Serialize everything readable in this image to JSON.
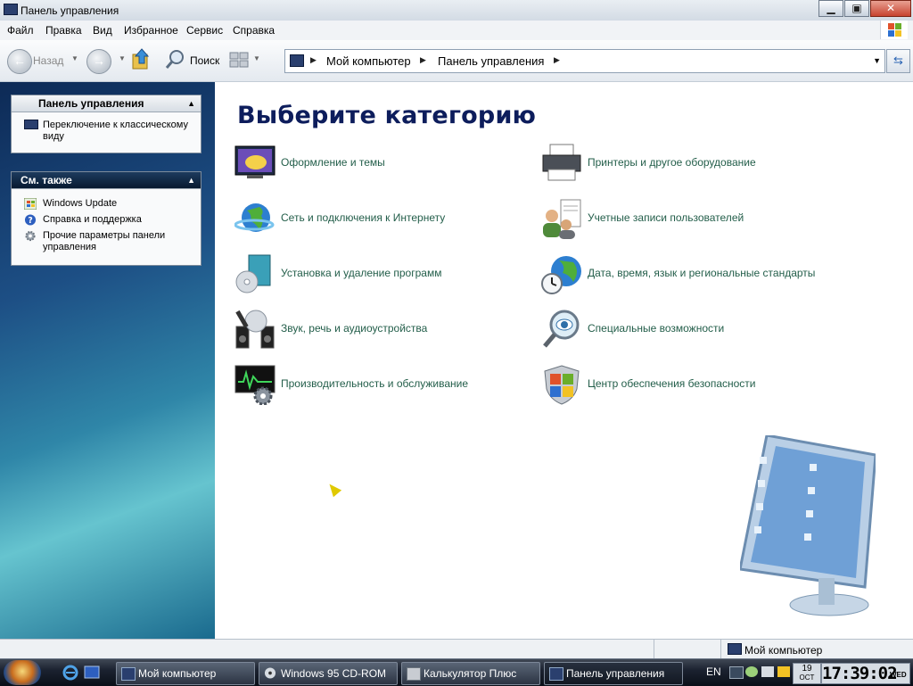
{
  "window": {
    "title": "Панель управления"
  },
  "menu": [
    "Файл",
    "Правка",
    "Вид",
    "Избранное",
    "Сервис",
    "Справка"
  ],
  "toolbar": {
    "back_label": "Назад",
    "search_label": "Поиск"
  },
  "address": {
    "crumbs": [
      "Мой компьютер",
      "Панель управления"
    ]
  },
  "left": {
    "panel1": {
      "title": "Панель управления",
      "items": [
        "Переключение к классическому виду"
      ]
    },
    "panel2": {
      "title": "См. также",
      "items": [
        "Windows Update",
        "Справка и поддержка",
        "Прочие параметры панели управления"
      ]
    }
  },
  "main": {
    "heading": "Выберите категорию",
    "categories": [
      {
        "label": "Оформление и темы",
        "icon": "appearance-icon"
      },
      {
        "label": "Принтеры и другое оборудование",
        "icon": "printer-icon"
      },
      {
        "label": "Сеть и подключения к Интернету",
        "icon": "network-globe-icon"
      },
      {
        "label": "Учетные записи пользователей",
        "icon": "user-accounts-icon"
      },
      {
        "label": "Установка и удаление программ",
        "icon": "add-remove-programs-icon"
      },
      {
        "label": "Дата, время, язык и региональные стандарты",
        "icon": "date-time-globe-icon"
      },
      {
        "label": "Звук, речь и аудиоустройства",
        "icon": "sound-icon"
      },
      {
        "label": "Специальные возможности",
        "icon": "accessibility-icon"
      },
      {
        "label": "Производительность и обслуживание",
        "icon": "performance-icon"
      },
      {
        "label": "Центр обеспечения безопасности",
        "icon": "security-shield-icon"
      }
    ]
  },
  "status": {
    "zone": "Мой компьютер"
  },
  "taskbar": {
    "tasks": [
      "Мой компьютер",
      "Windows 95 CD-ROM",
      "Калькулятор Плюс",
      "Панель управления"
    ],
    "lang": "EN",
    "date_day": "19",
    "date_month": "OCT",
    "time": "17:39:02",
    "weekday": "WED"
  },
  "colors": {
    "heading": "#0d1d5c",
    "link": "#235e4a",
    "accent": "#1d4f85"
  }
}
